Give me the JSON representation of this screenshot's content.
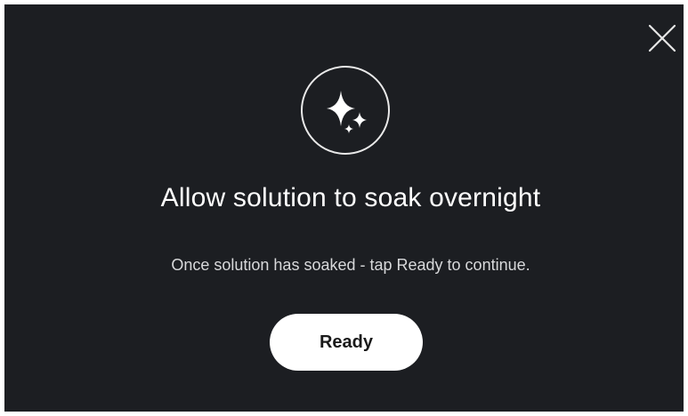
{
  "dialog": {
    "emblem_icon": "sparkles-icon",
    "close_icon": "close-icon",
    "title": "Allow solution to soak overnight",
    "message": "Once solution has soaked - tap Ready to continue.",
    "ready_label": "Ready"
  },
  "colors": {
    "background": "#1c1e22",
    "text": "#ffffff",
    "button_bg": "#ffffff",
    "button_text": "#1a1a1a"
  }
}
